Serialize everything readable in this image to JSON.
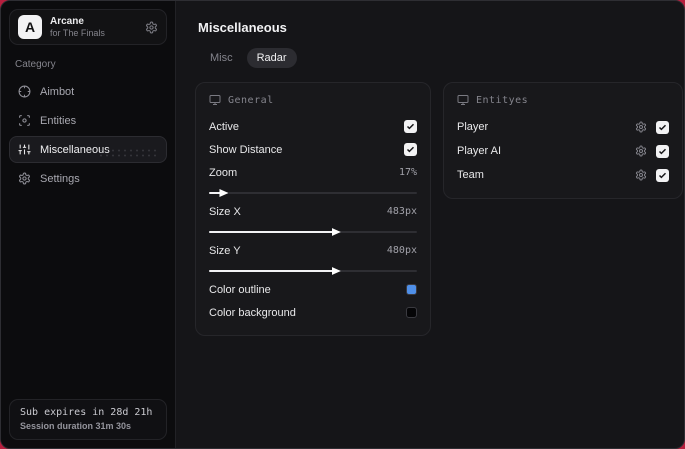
{
  "app": {
    "name": "Arcane",
    "subtitle": "for The Finals"
  },
  "sidebar": {
    "category_label": "Category",
    "items": [
      {
        "label": "Aimbot",
        "selected": false
      },
      {
        "label": "Entities",
        "selected": false
      },
      {
        "label": "Miscellaneous",
        "selected": true
      },
      {
        "label": "Settings",
        "selected": false
      }
    ],
    "subscription": {
      "expires_text": "Sub expires in 28d 21h",
      "session_text": "Session duration 31m 30s"
    }
  },
  "main": {
    "title": "Miscellaneous",
    "tabs": [
      {
        "label": "Misc",
        "active": false
      },
      {
        "label": "Radar",
        "active": true
      }
    ],
    "panels": {
      "general": {
        "title": "General",
        "toggles": [
          {
            "label": "Active",
            "checked": true
          },
          {
            "label": "Show Distance",
            "checked": true
          }
        ],
        "sliders": [
          {
            "label": "Zoom",
            "value": "17%",
            "fill": "6%"
          },
          {
            "label": "Size X",
            "value": "483px",
            "fill": "60%"
          },
          {
            "label": "Size Y",
            "value": "480px",
            "fill": "60%"
          }
        ],
        "colors": [
          {
            "label": "Color outline",
            "swatch": "#4f8fe8"
          },
          {
            "label": "Color background",
            "swatch": "#050507"
          }
        ]
      },
      "entities": {
        "title": "Entityes",
        "rows": [
          {
            "label": "Player",
            "checked": true
          },
          {
            "label": "Player AI",
            "checked": true
          },
          {
            "label": "Team",
            "checked": true
          }
        ]
      }
    }
  },
  "colors": {
    "accent_outline": "#4f8fe8",
    "desktop_background": "#b71f3e"
  }
}
